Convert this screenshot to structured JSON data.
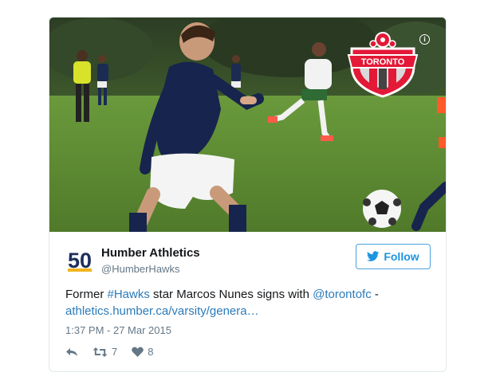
{
  "tweet": {
    "author_name": "Humber Athletics",
    "author_handle": "@HumberHawks",
    "avatar_text": "50",
    "follow_label": "Follow",
    "text_prefix": "Former ",
    "hashtag": "#Hawks",
    "text_middle": " star Marcos Nunes signs with ",
    "mention": "@torontofc",
    "text_suffix": " -",
    "link": "athletics.humber.ca/varsity/genera…",
    "timestamp": "1:37 PM - 27 Mar 2015",
    "retweet_count": "7",
    "like_count": "8"
  },
  "media": {
    "logo_text": "TORONTO",
    "info_icon": "i"
  },
  "icons": {
    "follow": "bird-icon",
    "reply": "reply-icon",
    "retweet": "retweet-icon",
    "like": "heart-icon"
  },
  "colors": {
    "link": "#2b7bb9",
    "follow": "#1b95e0",
    "muted": "#657786",
    "logo_red": "#e31937"
  }
}
